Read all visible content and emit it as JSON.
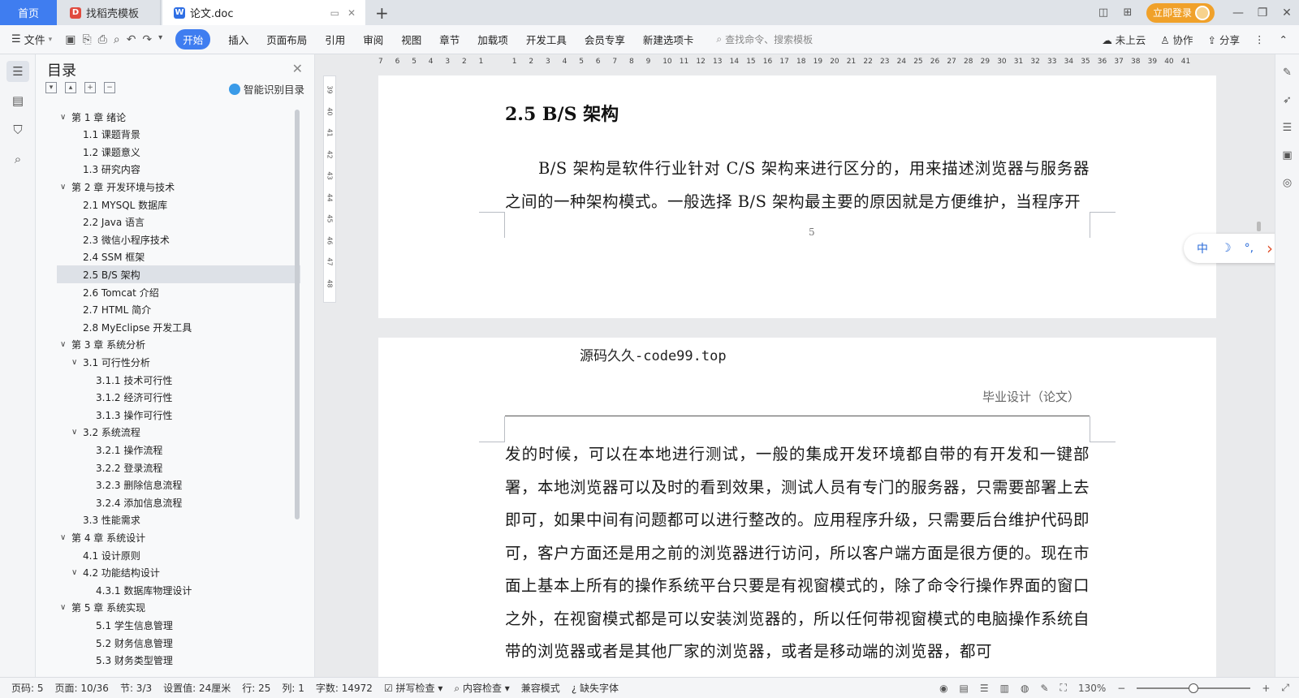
{
  "titlebar": {
    "tabs": [
      {
        "label": "首页"
      },
      {
        "label": "找稻壳模板"
      },
      {
        "label": "论文.doc"
      }
    ],
    "new_tab_symbol": "+",
    "login_label": "立即登录"
  },
  "ribbon": {
    "file_label": "文件",
    "tabs": [
      "开始",
      "插入",
      "页面布局",
      "引用",
      "审阅",
      "视图",
      "章节",
      "加载项",
      "开发工具",
      "会员专享",
      "新建选项卡"
    ],
    "search_placeholder": "查找命令、搜索模板",
    "right": {
      "cloud": "未上云",
      "collab": "协作",
      "share": "分享"
    }
  },
  "toc": {
    "title": "目录",
    "smart_label": "智能识别目录",
    "items": [
      {
        "label": "第 1 章  绪论",
        "level": 1
      },
      {
        "label": "1.1  课题背景",
        "level": 2
      },
      {
        "label": "1.2  课题意义",
        "level": 2
      },
      {
        "label": "1.3  研究内容",
        "level": 2
      },
      {
        "label": "第 2 章  开发环境与技术",
        "level": 1
      },
      {
        "label": "2.1 MYSQL 数据库",
        "level": 2
      },
      {
        "label": "2.2 Java 语言",
        "level": 2
      },
      {
        "label": "2.3  微信小程序技术",
        "level": 2
      },
      {
        "label": "2.4 SSM 框架",
        "level": 2
      },
      {
        "label": "2.5 B/S 架构",
        "level": 2,
        "selected": true
      },
      {
        "label": "2.6 Tomcat  介绍",
        "level": 2
      },
      {
        "label": "2.7 HTML 简介",
        "level": 2
      },
      {
        "label": "2.8 MyEclipse 开发工具",
        "level": 2
      },
      {
        "label": "第 3 章  系统分析",
        "level": 1
      },
      {
        "label": "3.1  可行性分析",
        "level": 2,
        "expandable": true
      },
      {
        "label": "3.1.1  技术可行性",
        "level": 3
      },
      {
        "label": "3.1.2  经济可行性",
        "level": 3
      },
      {
        "label": "3.1.3  操作可行性",
        "level": 3
      },
      {
        "label": "3.2  系统流程",
        "level": 2,
        "expandable": true
      },
      {
        "label": "3.2.1  操作流程",
        "level": 3
      },
      {
        "label": "3.2.2  登录流程",
        "level": 3
      },
      {
        "label": "3.2.3  删除信息流程",
        "level": 3
      },
      {
        "label": "3.2.4  添加信息流程",
        "level": 3
      },
      {
        "label": "3.3  性能需求",
        "level": 2
      },
      {
        "label": "第 4 章  系统设计",
        "level": 1
      },
      {
        "label": "4.1  设计原则",
        "level": 2
      },
      {
        "label": "4.2  功能结构设计",
        "level": 2,
        "expandable": true
      },
      {
        "label": "4.3.1  数据库物理设计",
        "level": 3
      },
      {
        "label": "第 5 章  系统实现",
        "level": 1
      },
      {
        "label": "5.1 学生信息管理",
        "level": 3
      },
      {
        "label": "5.2  财务信息管理",
        "level": 3
      },
      {
        "label": "5.3  财务类型管理",
        "level": 3
      }
    ]
  },
  "ruler": {
    "h_ticks": [
      "7",
      "6",
      "5",
      "4",
      "3",
      "2",
      "1",
      "",
      "1",
      "2",
      "3",
      "4",
      "5",
      "6",
      "7",
      "8",
      "9",
      "10",
      "11",
      "12",
      "13",
      "14",
      "15",
      "16",
      "17",
      "18",
      "19",
      "20",
      "21",
      "22",
      "23",
      "24",
      "25",
      "26",
      "27",
      "28",
      "29",
      "30",
      "31",
      "32",
      "33",
      "34",
      "35",
      "36",
      "37",
      "38",
      "39",
      "40",
      "41"
    ],
    "v_ticks": [
      "39",
      "40",
      "41",
      "42",
      "43",
      "44",
      "45",
      "46",
      "47",
      "48"
    ]
  },
  "document": {
    "heading": "2.5 B/S 架构",
    "para1": "B/S 架构是软件行业针对 C/S 架构来进行区分的，用来描述浏览器与服务器之间的一种架构模式。一般选择 B/S 架构最主要的原因就是方便维护，当程序开",
    "page_number": "5",
    "header_left": "源码久久-code99.top",
    "header_right": "毕业设计（论文）",
    "para2": "发的时候，可以在本地进行测试，一般的集成开发环境都自带的有开发和一键部署，本地浏览器可以及时的看到效果，测试人员有专门的服务器，只需要部署上去即可，如果中间有问题都可以进行整改的。应用程序升级，只需要后台维护代码即可，客户方面还是用之前的浏览器进行访问，所以客户端方面是很方便的。现在市面上基本上所有的操作系统平台只要是有视窗模式的，除了命令行操作界面的窗口之外，在视窗模式都是可以安装浏览器的，所以任何带视窗模式的电脑操作系统自带的浏览器或者是其他厂家的浏览器，或者是移动端的浏览器，都可"
  },
  "ime": {
    "lang": "中",
    "moon": "☽",
    "punct": "°,",
    "arrow": "›"
  },
  "status": {
    "page_code": "页码: 5",
    "page": "页面: 10/36",
    "section": "节: 3/3",
    "setting": "设置值: 24厘米",
    "row": "行: 25",
    "col": "列: 1",
    "words": "字数: 14972",
    "spell": "拼写检查",
    "content_check": "内容检查",
    "compat": "兼容模式",
    "missing_font": "缺失字体",
    "zoom": "130%",
    "zoom_level": 0.5
  },
  "colors": {
    "accent": "#3f7df0",
    "login": "#f0a12a"
  }
}
